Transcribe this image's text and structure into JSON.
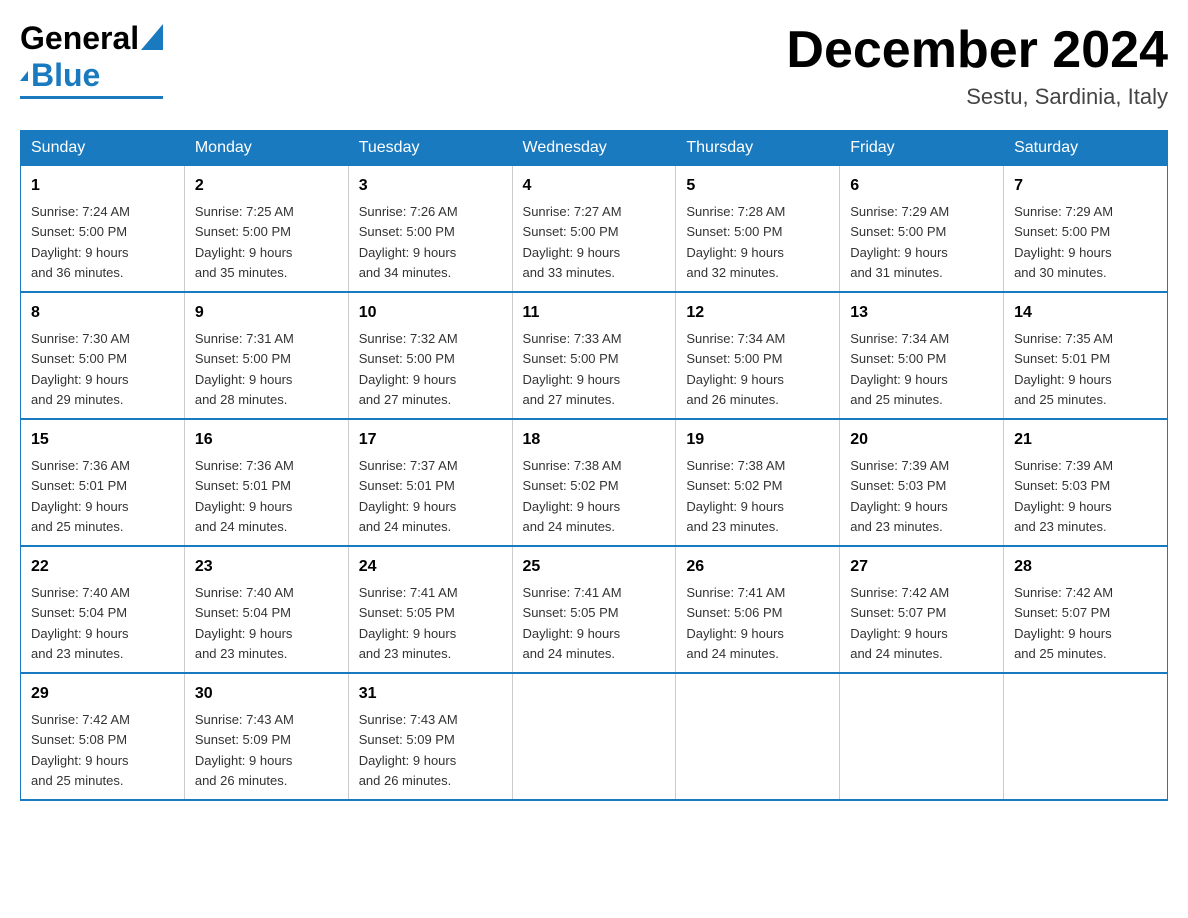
{
  "header": {
    "logo_text_general": "General",
    "logo_text_blue": "Blue",
    "month_title": "December 2024",
    "location": "Sestu, Sardinia, Italy"
  },
  "days_of_week": [
    "Sunday",
    "Monday",
    "Tuesday",
    "Wednesday",
    "Thursday",
    "Friday",
    "Saturday"
  ],
  "weeks": [
    [
      {
        "day": "1",
        "sunrise": "7:24 AM",
        "sunset": "5:00 PM",
        "daylight": "9 hours and 36 minutes."
      },
      {
        "day": "2",
        "sunrise": "7:25 AM",
        "sunset": "5:00 PM",
        "daylight": "9 hours and 35 minutes."
      },
      {
        "day": "3",
        "sunrise": "7:26 AM",
        "sunset": "5:00 PM",
        "daylight": "9 hours and 34 minutes."
      },
      {
        "day": "4",
        "sunrise": "7:27 AM",
        "sunset": "5:00 PM",
        "daylight": "9 hours and 33 minutes."
      },
      {
        "day": "5",
        "sunrise": "7:28 AM",
        "sunset": "5:00 PM",
        "daylight": "9 hours and 32 minutes."
      },
      {
        "day": "6",
        "sunrise": "7:29 AM",
        "sunset": "5:00 PM",
        "daylight": "9 hours and 31 minutes."
      },
      {
        "day": "7",
        "sunrise": "7:29 AM",
        "sunset": "5:00 PM",
        "daylight": "9 hours and 30 minutes."
      }
    ],
    [
      {
        "day": "8",
        "sunrise": "7:30 AM",
        "sunset": "5:00 PM",
        "daylight": "9 hours and 29 minutes."
      },
      {
        "day": "9",
        "sunrise": "7:31 AM",
        "sunset": "5:00 PM",
        "daylight": "9 hours and 28 minutes."
      },
      {
        "day": "10",
        "sunrise": "7:32 AM",
        "sunset": "5:00 PM",
        "daylight": "9 hours and 27 minutes."
      },
      {
        "day": "11",
        "sunrise": "7:33 AM",
        "sunset": "5:00 PM",
        "daylight": "9 hours and 27 minutes."
      },
      {
        "day": "12",
        "sunrise": "7:34 AM",
        "sunset": "5:00 PM",
        "daylight": "9 hours and 26 minutes."
      },
      {
        "day": "13",
        "sunrise": "7:34 AM",
        "sunset": "5:00 PM",
        "daylight": "9 hours and 25 minutes."
      },
      {
        "day": "14",
        "sunrise": "7:35 AM",
        "sunset": "5:01 PM",
        "daylight": "9 hours and 25 minutes."
      }
    ],
    [
      {
        "day": "15",
        "sunrise": "7:36 AM",
        "sunset": "5:01 PM",
        "daylight": "9 hours and 25 minutes."
      },
      {
        "day": "16",
        "sunrise": "7:36 AM",
        "sunset": "5:01 PM",
        "daylight": "9 hours and 24 minutes."
      },
      {
        "day": "17",
        "sunrise": "7:37 AM",
        "sunset": "5:01 PM",
        "daylight": "9 hours and 24 minutes."
      },
      {
        "day": "18",
        "sunrise": "7:38 AM",
        "sunset": "5:02 PM",
        "daylight": "9 hours and 24 minutes."
      },
      {
        "day": "19",
        "sunrise": "7:38 AM",
        "sunset": "5:02 PM",
        "daylight": "9 hours and 23 minutes."
      },
      {
        "day": "20",
        "sunrise": "7:39 AM",
        "sunset": "5:03 PM",
        "daylight": "9 hours and 23 minutes."
      },
      {
        "day": "21",
        "sunrise": "7:39 AM",
        "sunset": "5:03 PM",
        "daylight": "9 hours and 23 minutes."
      }
    ],
    [
      {
        "day": "22",
        "sunrise": "7:40 AM",
        "sunset": "5:04 PM",
        "daylight": "9 hours and 23 minutes."
      },
      {
        "day": "23",
        "sunrise": "7:40 AM",
        "sunset": "5:04 PM",
        "daylight": "9 hours and 23 minutes."
      },
      {
        "day": "24",
        "sunrise": "7:41 AM",
        "sunset": "5:05 PM",
        "daylight": "9 hours and 23 minutes."
      },
      {
        "day": "25",
        "sunrise": "7:41 AM",
        "sunset": "5:05 PM",
        "daylight": "9 hours and 24 minutes."
      },
      {
        "day": "26",
        "sunrise": "7:41 AM",
        "sunset": "5:06 PM",
        "daylight": "9 hours and 24 minutes."
      },
      {
        "day": "27",
        "sunrise": "7:42 AM",
        "sunset": "5:07 PM",
        "daylight": "9 hours and 24 minutes."
      },
      {
        "day": "28",
        "sunrise": "7:42 AM",
        "sunset": "5:07 PM",
        "daylight": "9 hours and 25 minutes."
      }
    ],
    [
      {
        "day": "29",
        "sunrise": "7:42 AM",
        "sunset": "5:08 PM",
        "daylight": "9 hours and 25 minutes."
      },
      {
        "day": "30",
        "sunrise": "7:43 AM",
        "sunset": "5:09 PM",
        "daylight": "9 hours and 26 minutes."
      },
      {
        "day": "31",
        "sunrise": "7:43 AM",
        "sunset": "5:09 PM",
        "daylight": "9 hours and 26 minutes."
      },
      null,
      null,
      null,
      null
    ]
  ],
  "labels": {
    "sunrise": "Sunrise:",
    "sunset": "Sunset:",
    "daylight": "Daylight:"
  }
}
